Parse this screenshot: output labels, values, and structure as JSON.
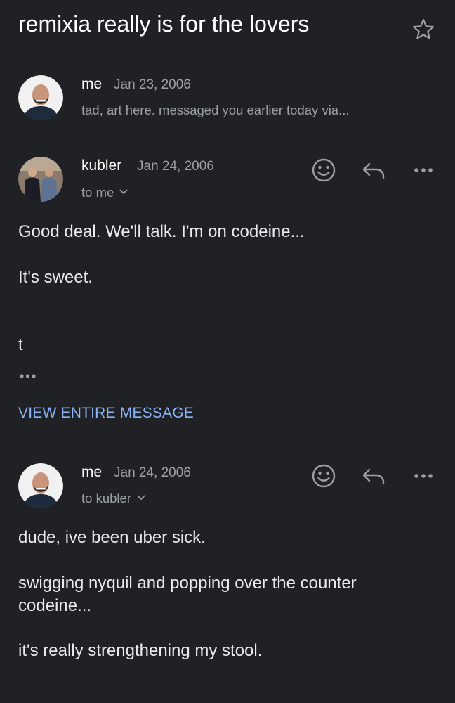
{
  "thread": {
    "subject": "remixia really is for the lovers"
  },
  "messages": [
    {
      "sender": "me",
      "date": "Jan 23, 2006",
      "snippet": "tad, art here. messaged you earlier today via..."
    },
    {
      "sender": "kubler",
      "date": "Jan 24, 2006",
      "recipients": "to me",
      "body": [
        "Good deal. We'll talk. I'm on codeine...",
        "It's sweet.",
        "t"
      ],
      "view_entire_label": "VIEW ENTIRE MESSAGE"
    },
    {
      "sender": "me",
      "date": "Jan 24, 2006",
      "recipients": "to kubler",
      "body": [
        "dude, ive been uber sick.",
        "swigging nyquil and popping over the counter",
        "codeine...",
        "it's really strengthening my stool."
      ]
    }
  ],
  "icons": {
    "star": "star-outline-icon",
    "emoji": "smiley-icon",
    "reply": "reply-arrow-icon",
    "more": "more-horizontal-icon",
    "expand": "chevron-down-icon",
    "trimmed": "ellipsis-icon"
  },
  "colors": {
    "background": "#202124",
    "primary_text": "#ffffff",
    "secondary_text": "#9aa0a6",
    "link": "#8ab4f8",
    "divider": "#3c4043"
  }
}
